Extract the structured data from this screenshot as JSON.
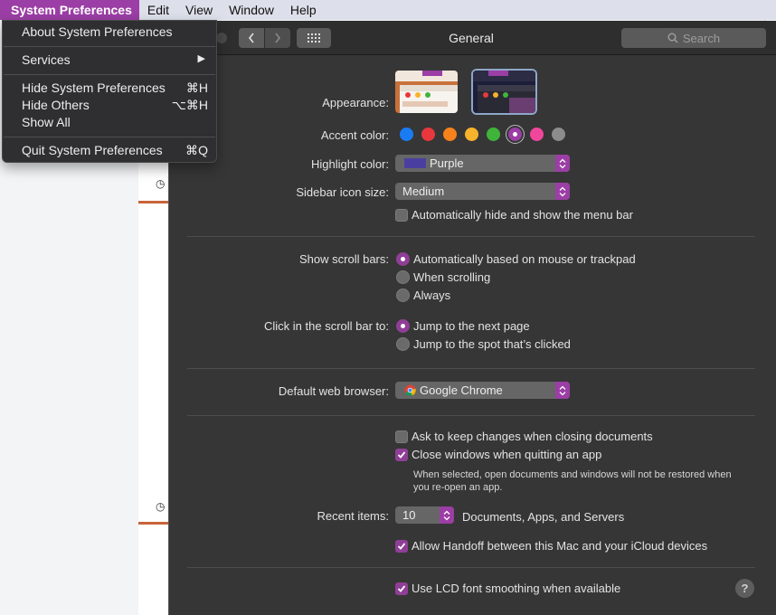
{
  "menubar": {
    "items": [
      "System Preferences",
      "Edit",
      "View",
      "Window",
      "Help"
    ]
  },
  "app_menu": {
    "about": "About System Preferences",
    "services": "Services",
    "hide": "Hide System Preferences",
    "hide_shortcut": "⌘H",
    "hide_others": "Hide Others",
    "hide_others_shortcut": "⌥⌘H",
    "show_all": "Show All",
    "quit": "Quit System Preferences",
    "quit_shortcut": "⌘Q"
  },
  "window": {
    "title": "General",
    "search_placeholder": "Search"
  },
  "appearance": {
    "label": "Appearance:",
    "options": [
      "light",
      "dark"
    ],
    "selected": "dark"
  },
  "accent": {
    "label": "Accent color:",
    "colors": [
      "#1a7cf5",
      "#e8383d",
      "#f7821b",
      "#f7b32b",
      "#3fb43a",
      "#9b3ea5",
      "#f0479d",
      "#8c8c8c"
    ],
    "selected_index": 5
  },
  "highlight": {
    "label": "Highlight color:",
    "value": "Purple",
    "swatch": "#4a3fa0"
  },
  "sidebar_icon": {
    "label": "Sidebar icon size:",
    "value": "Medium"
  },
  "menu_bar_autohide": {
    "label": "Automatically hide and show the menu bar",
    "checked": false
  },
  "scroll_bars": {
    "label": "Show scroll bars:",
    "options": [
      "Automatically based on mouse or trackpad",
      "When scrolling",
      "Always"
    ],
    "selected_index": 0
  },
  "click_scroll": {
    "label": "Click in the scroll bar to:",
    "options": [
      "Jump to the next page",
      "Jump to the spot that’s clicked"
    ],
    "selected_index": 0
  },
  "browser": {
    "label": "Default web browser:",
    "value": "Google Chrome"
  },
  "ask_keep_changes": {
    "label": "Ask to keep changes when closing documents",
    "checked": false
  },
  "close_windows": {
    "label": "Close windows when quitting an app",
    "checked": true,
    "note": "When selected, open documents and windows will not be restored when you re-open an app."
  },
  "recent_items": {
    "label": "Recent items:",
    "value": "10",
    "suffix": "Documents, Apps, and Servers"
  },
  "handoff": {
    "label": "Allow Handoff between this Mac and your iCloud devices",
    "checked": true
  },
  "lcd_smoothing": {
    "label": "Use LCD font smoothing when available",
    "checked": true
  },
  "help": "?"
}
